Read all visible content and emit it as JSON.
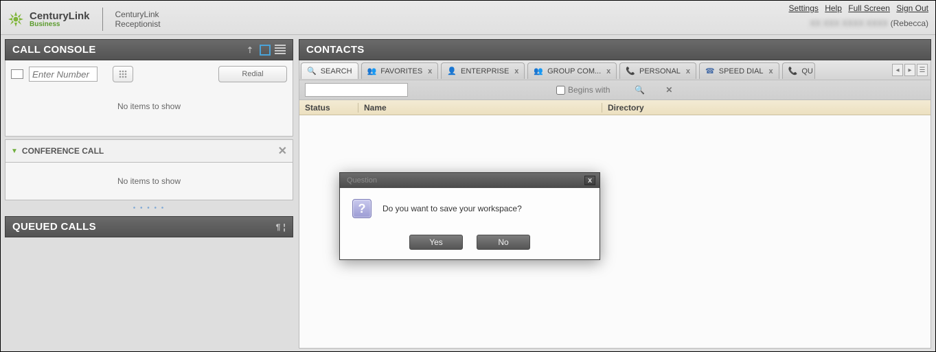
{
  "header": {
    "brand": "CenturyLink",
    "subbrand": "Business",
    "product_line1": "CenturyLink",
    "product_line2": "Receptionist",
    "links": {
      "settings": "Settings",
      "help": "Help",
      "fullscreen": "Full Screen",
      "signout": "Sign Out"
    },
    "user_display": "(Rebecca)"
  },
  "call_console": {
    "title": "CALL CONSOLE",
    "dial_placeholder": "Enter Number",
    "redial_label": "Redial",
    "no_items": "No items to show",
    "conference": {
      "title": "CONFERENCE CALL",
      "no_items": "No items to show"
    }
  },
  "queued": {
    "title": "QUEUED CALLS"
  },
  "contacts": {
    "title": "CONTACTS",
    "tabs": [
      {
        "label": "SEARCH",
        "closable": false
      },
      {
        "label": "FAVORITES",
        "closable": true
      },
      {
        "label": "ENTERPRISE",
        "closable": true
      },
      {
        "label": "GROUP COM...",
        "closable": true
      },
      {
        "label": "PERSONAL",
        "closable": true
      },
      {
        "label": "SPEED DIAL",
        "closable": true
      },
      {
        "label": "QU",
        "closable": false
      }
    ],
    "filter": {
      "begins_with": "Begins with"
    },
    "columns": {
      "status": "Status",
      "name": "Name",
      "directory": "Directory"
    }
  },
  "dialog": {
    "title": "Question",
    "message": "Do you want to save your workspace?",
    "yes": "Yes",
    "no": "No"
  }
}
